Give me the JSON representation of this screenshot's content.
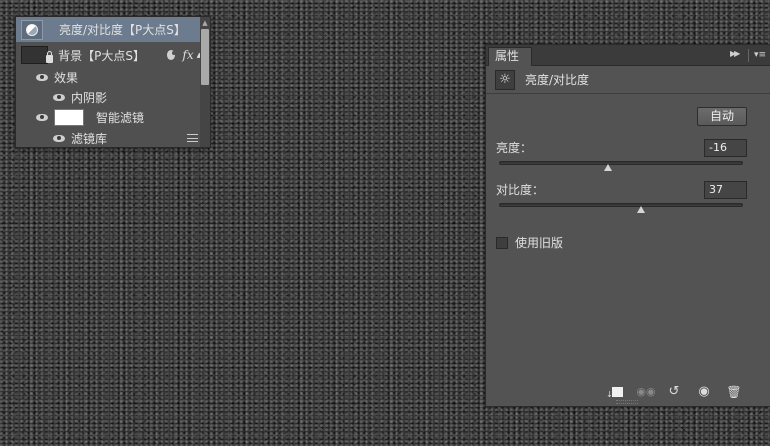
{
  "layers": {
    "items": [
      {
        "name": "亮度/对比度【P大点S】",
        "kind": "adjustment",
        "selected": true
      },
      {
        "name": "背景【P大点S】",
        "kind": "smart-object",
        "fx": "fx"
      },
      {
        "name": "效果",
        "kind": "effects-group"
      },
      {
        "name": "内阴影",
        "kind": "effect"
      },
      {
        "name": "智能滤镜",
        "kind": "smart-filters"
      },
      {
        "name": "滤镜库",
        "kind": "filter"
      }
    ]
  },
  "properties": {
    "tab_label": "属性",
    "header_title": "亮度/对比度",
    "header_icon": "sun-icon",
    "auto_button": "自动",
    "brightness": {
      "label": "亮度：",
      "value": "-16",
      "min": -150,
      "max": 150
    },
    "contrast": {
      "label": "对比度：",
      "value": "37",
      "min": -50,
      "max": 100
    },
    "legacy": {
      "label": "使用旧版",
      "checked": false
    },
    "footer_icons": [
      "clip-to-layer-icon",
      "view-previous-state-icon",
      "reset-icon",
      "toggle-visibility-icon",
      "delete-icon"
    ]
  },
  "colors": {
    "selected_layer": "#6c7b8e",
    "panel_bg": "#535353",
    "canvas_texture": "#3a3a3a"
  }
}
